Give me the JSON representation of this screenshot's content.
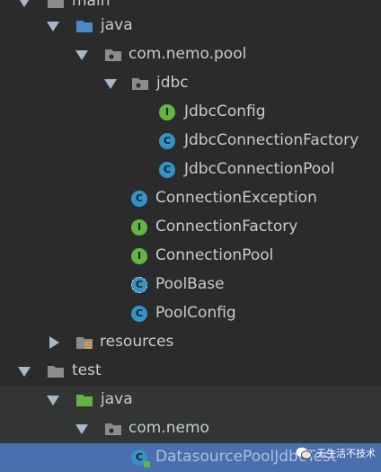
{
  "tree": {
    "main_label": "main",
    "java_main_label": "java",
    "pkg_pool_label": "com.nemo.pool",
    "pkg_jdbc_label": "jdbc",
    "jdbc_config_label": "JdbcConfig",
    "jdbc_conn_factory_label": "JdbcConnectionFactory",
    "jdbc_conn_pool_label": "JdbcConnectionPool",
    "conn_exception_label": "ConnectionException",
    "conn_factory_label": "ConnectionFactory",
    "conn_pool_label": "ConnectionPool",
    "pool_base_label": "PoolBase",
    "pool_config_label": "PoolConfig",
    "resources_label": "resources",
    "test_label": "test",
    "java_test_label": "java",
    "pkg_nemo_label": "com.nemo",
    "ds_pool_test_label": "DatasourcePoolJdbcTest"
  },
  "badges": {
    "class_letter": "C",
    "interface_letter": "I"
  },
  "watermark": {
    "text": "无生活不技术"
  },
  "colors": {
    "background": "#2b2b2b",
    "selected_row": "#4b6eaf",
    "class_badge": "#3592c4",
    "interface_badge": "#62b543",
    "source_folder": "#4a88c7",
    "test_folder": "#62b543"
  }
}
